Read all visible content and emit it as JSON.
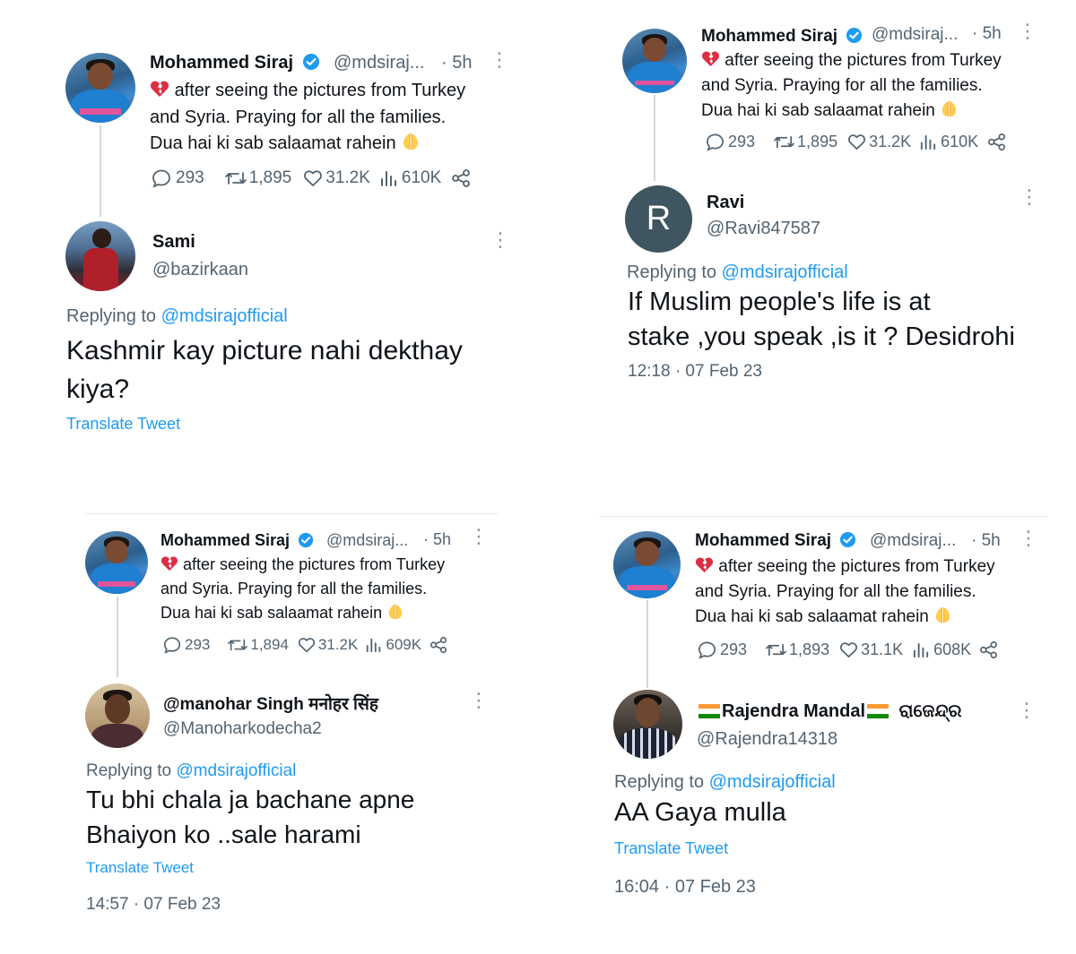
{
  "original_tweet": {
    "author_name": "Mohammed Siraj",
    "author_handle": "@mdsiraj...",
    "age": "· 5h",
    "text_lines": [
      "after seeing the pictures from Turkey",
      "and Syria. Praying for all the families.",
      "Dua hai ki sab salaamat rahein"
    ],
    "emoji_prefix": "broken-heart-icon",
    "emoji_suffix": "praying-hands-icon",
    "verified_color": "#1d9bf0"
  },
  "panels": [
    {
      "stats": {
        "replies": "293",
        "retweets": "1,895",
        "likes": "31.2K",
        "views": "610K"
      },
      "reply": {
        "author_name": "Sami",
        "author_handle": "@bazirkaan",
        "replying_label": "Replying to",
        "replying_to": "@mdsirajofficial",
        "text_lines": [
          "Kashmir kay picture nahi dekthay",
          "kiya?"
        ],
        "translate_label": "Translate Tweet"
      }
    },
    {
      "stats": {
        "replies": "293",
        "retweets": "1,895",
        "likes": "31.2K",
        "views": "610K"
      },
      "reply": {
        "author_name": "Ravi",
        "author_handle": "@Ravi847587",
        "avatar_letter": "R",
        "replying_label": "Replying to",
        "replying_to": "@mdsirajofficial",
        "text_lines": [
          "If Muslim people's life is at",
          "stake ,you speak ,is it ? Desidrohi"
        ],
        "timestamp": "12:18 · 07 Feb 23"
      }
    },
    {
      "stats": {
        "replies": "293",
        "retweets": "1,894",
        "likes": "31.2K",
        "views": "609K"
      },
      "reply": {
        "author_name": "@manohar Singh मनोहर सिंह",
        "author_handle": "@Manoharkodecha2",
        "replying_label": "Replying to",
        "replying_to": "@mdsirajofficial",
        "text_lines": [
          "Tu bhi chala ja bachane apne",
          "Bhaiyon ko ..sale harami"
        ],
        "translate_label": "Translate Tweet",
        "timestamp": "14:57 · 07 Feb 23"
      }
    },
    {
      "stats": {
        "replies": "293",
        "retweets": "1,893",
        "likes": "31.1K",
        "views": "608K"
      },
      "reply": {
        "author_name": "Rajendra Mandal",
        "author_name_suffix": "ରାଜେନ୍ଦ୍ର",
        "author_handle": "@Rajendra14318",
        "replying_label": "Replying to",
        "replying_to": "@mdsirajofficial",
        "text_lines": [
          "AA Gaya mulla"
        ],
        "translate_label": "Translate Tweet",
        "timestamp": "16:04 · 07 Feb 23"
      }
    }
  ],
  "colors": {
    "link": "#1d9bf0",
    "secondary_text": "#536471",
    "primary_text": "#0f1419",
    "thread_line": "#cfd9de"
  }
}
